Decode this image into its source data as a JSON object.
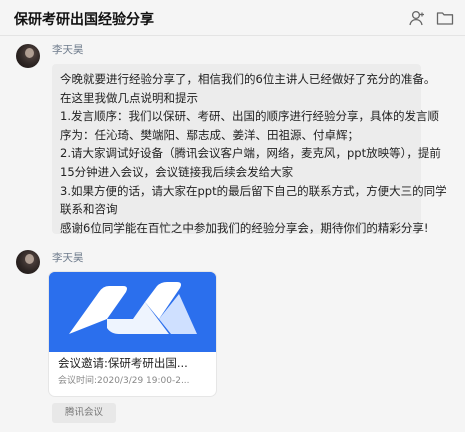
{
  "header": {
    "title": "保研考研出国经验分享",
    "icons": [
      "person-icon",
      "folder-icon"
    ]
  },
  "messages": [
    {
      "sender": "李天昊",
      "lines": [
        "今晚就要进行经验分享了，相信我们的6位主讲人已经做好了充分的准备。",
        "在这里我做几点说明和提示",
        "1.发言顺序：我们以保研、考研、出国的顺序进行经验分享，具体的发言顺",
        "序为：任沁琦、樊端阳、鄢志成、姜洋、田祖源、付卓辉；",
        "2.请大家调试好设备（腾讯会议客户端，网络，麦克风，ppt放映等），提前",
        "15分钟进入会议，会议链接我后续会发给大家",
        "3.如果方便的话，请大家在ppt的最后留下自己的联系方式，方便大三的同学",
        "联系和咨询",
        "感谢6位同学能在百忙之中参加我们的经验分享会，期待你们的精彩分享!"
      ]
    },
    {
      "sender": "李天昊",
      "card": {
        "title": "会议邀请:保研考研出国...",
        "time": "会议时间:2020/3/29 19:00-2...",
        "source": "腾讯会议",
        "colors": {
          "background": "#2b6fed",
          "logo": "#ffffff"
        }
      }
    }
  ]
}
